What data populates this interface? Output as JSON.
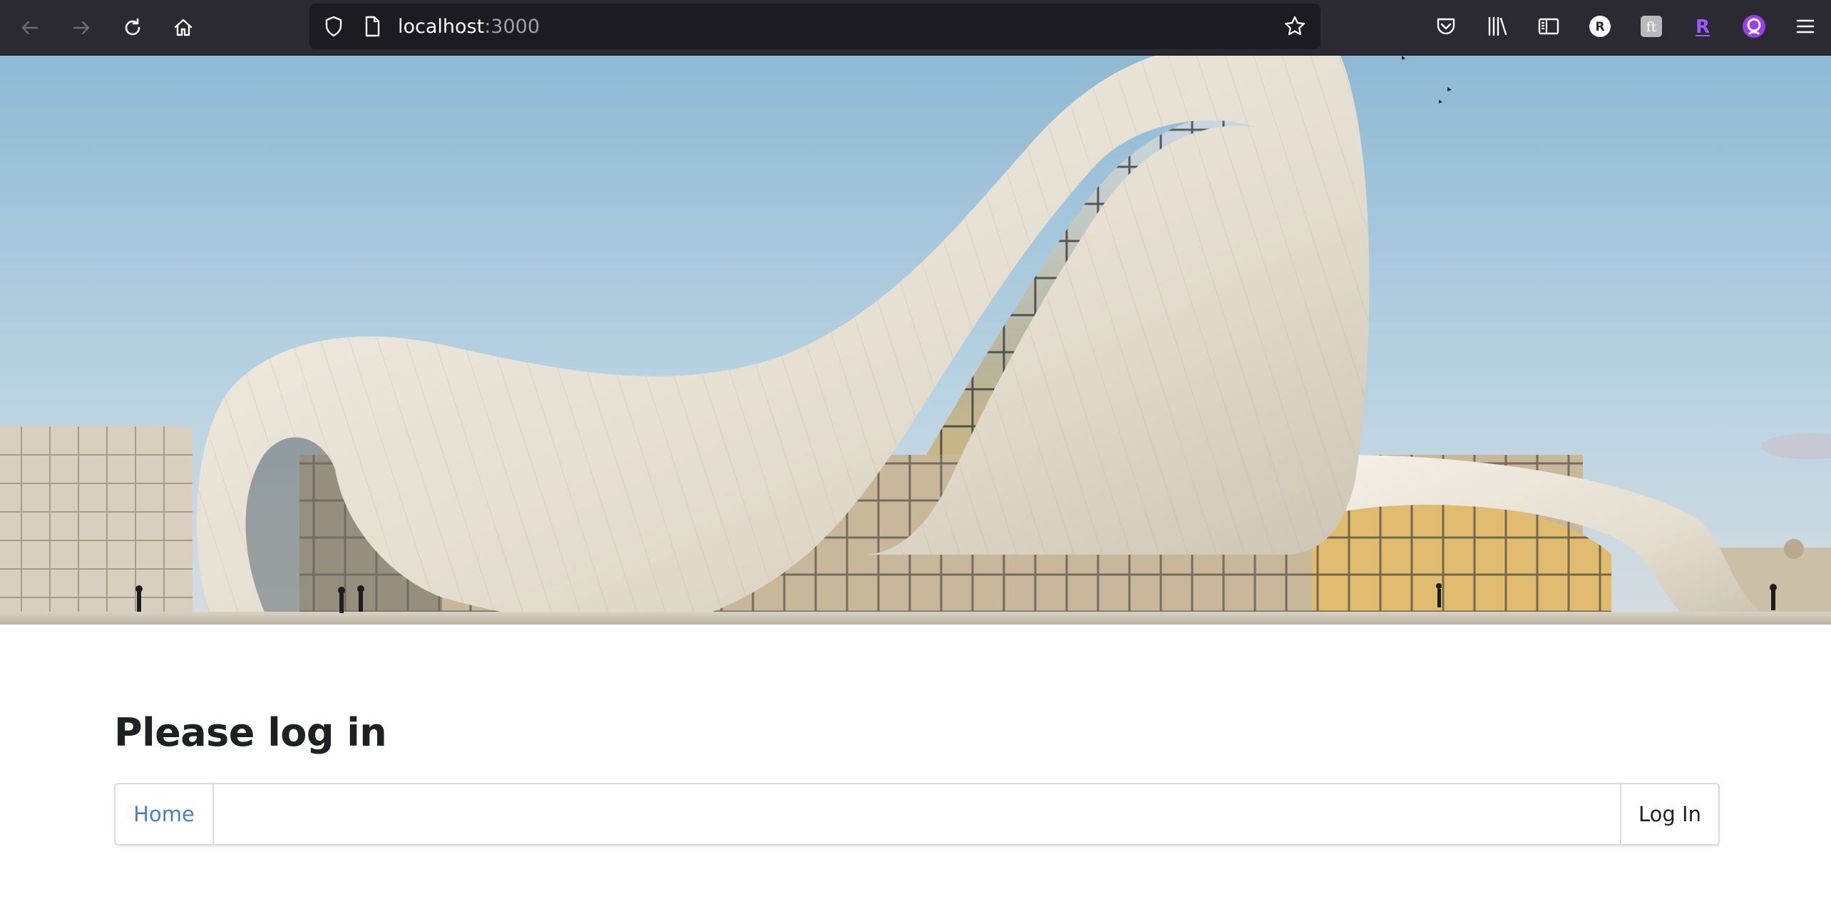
{
  "browser": {
    "url_host": "localhost",
    "url_port": ":3000",
    "icons": [
      "back-arrow-icon",
      "forward-arrow-icon",
      "reload-icon",
      "home-icon",
      "shield-icon",
      "page-icon",
      "bookmark-star-icon",
      "pocket-icon",
      "library-icon",
      "sidebar-icon",
      "profile-r-icon",
      "extension-icon",
      "extension-r-icon",
      "firefox-account-icon",
      "menu-icon"
    ],
    "profile_letter": "R",
    "ext_letter": "R"
  },
  "hero": {
    "image": "architecture-photo",
    "sky_color": "#a9c9dd",
    "building_color": "#eae4d8"
  },
  "page": {
    "title": "Please log in"
  },
  "navbar": {
    "home_label": "Home",
    "login_label": "Log In",
    "link_color": "#4a7fc1"
  }
}
